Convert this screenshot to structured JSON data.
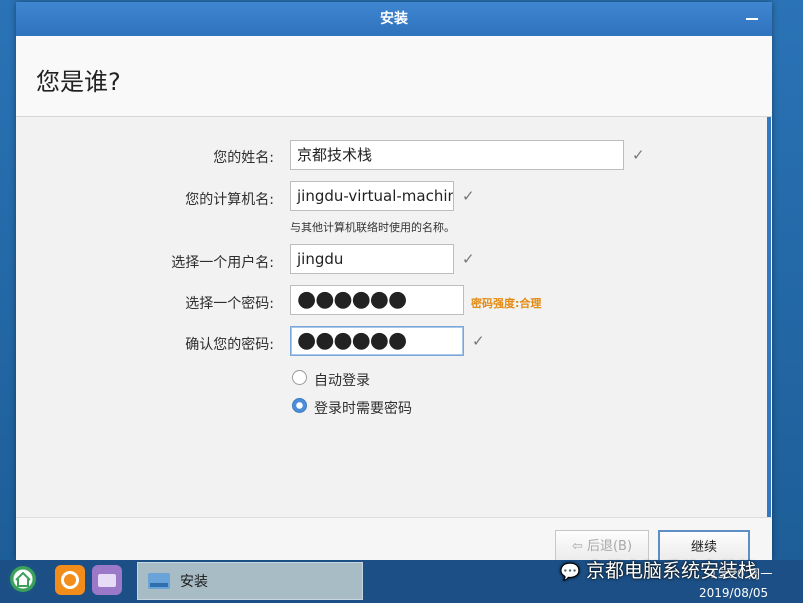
{
  "window": {
    "title": "安装",
    "heading": "您是谁?"
  },
  "form": {
    "name_label": "您的姓名:",
    "name_value": "京都技术栈",
    "computer_label": "您的计算机名:",
    "computer_value": "jingdu-virtual-machine",
    "computer_hint": "与其他计算机联络时使用的名称。",
    "username_label": "选择一个用户名:",
    "username_value": "jingdu",
    "password_label": "选择一个密码:",
    "password_value": "●●●●●●",
    "password_strength": "密码强度:合理",
    "confirm_label": "确认您的密码:",
    "confirm_value": "●●●●●●",
    "check_mark": "✓",
    "auto_login_label": "自动登录",
    "require_password_label": "登录时需要密码",
    "selected_option": "登录时需要密码"
  },
  "buttons": {
    "back_label": "后退(B)",
    "continue_label": "继续"
  },
  "taskbar": {
    "task_label": "安装",
    "time": "15:20 周一",
    "date": "2019/08/05"
  },
  "watermark": "京都电脑系统安装栈",
  "colors": {
    "title_bar": "#3a7fcb",
    "accent": "#3578c2",
    "strength_text": "#e38b12",
    "taskbar": "#1b4f85"
  }
}
